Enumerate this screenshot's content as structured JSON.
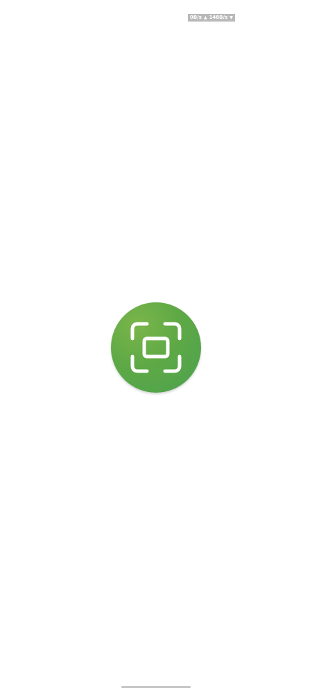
{
  "status_bar": {
    "upload_speed": "0B/s",
    "upload_arrow": "▲",
    "download_speed": "148B/s",
    "download_arrow": "▼"
  },
  "splash": {
    "logo_icon": "scan-frame-icon",
    "logo_color": "#5ea946"
  }
}
